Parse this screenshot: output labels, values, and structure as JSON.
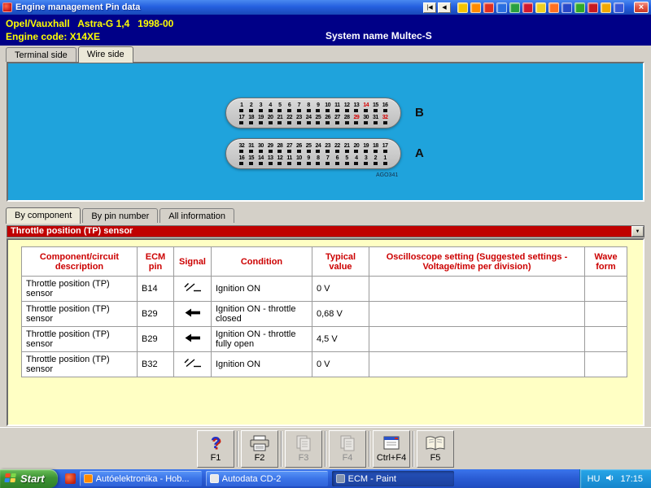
{
  "titlebar": {
    "title": "Engine management Pin data",
    "nav_buttons": [
      "|◀",
      "◀"
    ],
    "icons": [
      {
        "name": "launcher-icon-1",
        "color": "#f5c400"
      },
      {
        "name": "launcher-icon-2",
        "color": "#ff8a00"
      },
      {
        "name": "launcher-icon-3",
        "color": "#e03020"
      },
      {
        "name": "launcher-icon-4",
        "color": "#2a6fe0"
      },
      {
        "name": "launcher-icon-5",
        "color": "#28a040"
      },
      {
        "name": "launcher-icon-6",
        "color": "#d01830"
      },
      {
        "name": "launcher-icon-7",
        "color": "#f0d020"
      },
      {
        "name": "launcher-icon-8",
        "color": "#ff7020"
      },
      {
        "name": "launcher-icon-9",
        "color": "#2848c8"
      },
      {
        "name": "launcher-icon-10",
        "color": "#30a828"
      },
      {
        "name": "launcher-icon-11",
        "color": "#c81820"
      },
      {
        "name": "launcher-icon-12",
        "color": "#f0a800"
      },
      {
        "name": "launcher-icon-13",
        "color": "#3858d8"
      }
    ],
    "close_label": "×"
  },
  "header": {
    "vehicle": "Opel/Vauxhall   Astra-G 1,4   1998-00",
    "engine_code": "Engine code: X14XE",
    "system_name": "System name Multec-S"
  },
  "view_tabs": [
    {
      "label": "Terminal side",
      "active": false
    },
    {
      "label": "Wire side",
      "active": true
    }
  ],
  "connector_panel": {
    "caption": "AGO341",
    "connectors": [
      {
        "label": "B",
        "row1": [
          "1",
          "2",
          "3",
          "4",
          "5",
          "6",
          "7",
          "8",
          "9",
          "10",
          "11",
          "12",
          "13",
          "14",
          "15",
          "16"
        ],
        "row2": [
          "17",
          "18",
          "19",
          "20",
          "21",
          "22",
          "23",
          "24",
          "25",
          "26",
          "27",
          "28",
          "29",
          "30",
          "31",
          "32"
        ],
        "highlight": [
          "14",
          "29",
          "32"
        ]
      },
      {
        "label": "A",
        "row1": [
          "32",
          "31",
          "30",
          "29",
          "28",
          "27",
          "26",
          "25",
          "24",
          "23",
          "22",
          "21",
          "20",
          "19",
          "18",
          "17"
        ],
        "row2": [
          "16",
          "15",
          "14",
          "13",
          "12",
          "11",
          "10",
          "9",
          "8",
          "7",
          "6",
          "5",
          "4",
          "3",
          "2",
          "1"
        ],
        "highlight": []
      }
    ]
  },
  "info_tabs": [
    {
      "label": "By component",
      "active": true
    },
    {
      "label": "By pin number",
      "active": false
    },
    {
      "label": "All information",
      "active": false
    }
  ],
  "component_selector": {
    "value": "Throttle position (TP) sensor",
    "dropdown_glyph": "▼"
  },
  "pin_table": {
    "headers": [
      "Component/circuit\ndescription",
      "ECM\npin",
      "Signal",
      "Condition",
      "Typical\nvalue",
      "Oscilloscope setting (Suggested settings -\nVoltage/time per division)",
      "Wave\nform"
    ],
    "rows": [
      {
        "description": "Throttle position (TP) sensor",
        "ecm_pin": "B14",
        "signal": "switch-icon",
        "condition": "Ignition ON",
        "typical_value": "0 V",
        "oscilloscope": "",
        "wave_form": ""
      },
      {
        "description": "Throttle position (TP) sensor",
        "ecm_pin": "B29",
        "signal": "arrow-left-icon",
        "condition": "Ignition ON - throttle closed",
        "typical_value": "0,68 V",
        "oscilloscope": "",
        "wave_form": ""
      },
      {
        "description": "Throttle position (TP) sensor",
        "ecm_pin": "B29",
        "signal": "arrow-left-icon",
        "condition": "Ignition ON - throttle fully open",
        "typical_value": "4,5 V",
        "oscilloscope": "",
        "wave_form": ""
      },
      {
        "description": "Throttle position (TP) sensor",
        "ecm_pin": "B32",
        "signal": "switch-icon",
        "condition": "Ignition ON",
        "typical_value": "0 V",
        "oscilloscope": "",
        "wave_form": ""
      }
    ]
  },
  "function_bar": [
    {
      "key": "F1",
      "icon": "help-icon",
      "enabled": true
    },
    {
      "key": "F2",
      "icon": "print-icon",
      "enabled": true
    },
    {
      "key": "F3",
      "icon": "pages-icon",
      "enabled": false
    },
    {
      "key": "F4",
      "icon": "pages-icon",
      "enabled": false
    },
    {
      "key": "Ctrl+F4",
      "icon": "window-icon",
      "enabled": true
    },
    {
      "key": "F5",
      "icon": "book-icon",
      "enabled": true
    }
  ],
  "taskbar": {
    "start_label": "Start",
    "windows": [
      {
        "label": "Autóelektronika - Hob...",
        "icon_color": "#ff8a00",
        "active": false
      },
      {
        "label": "Autodata CD-2",
        "icon_color": "#e8e8e8",
        "active": false
      },
      {
        "label": "ECM - Paint",
        "icon_color": "#8494b0",
        "active": true
      }
    ],
    "tray": {
      "language": "HU",
      "time": "17:15"
    }
  }
}
